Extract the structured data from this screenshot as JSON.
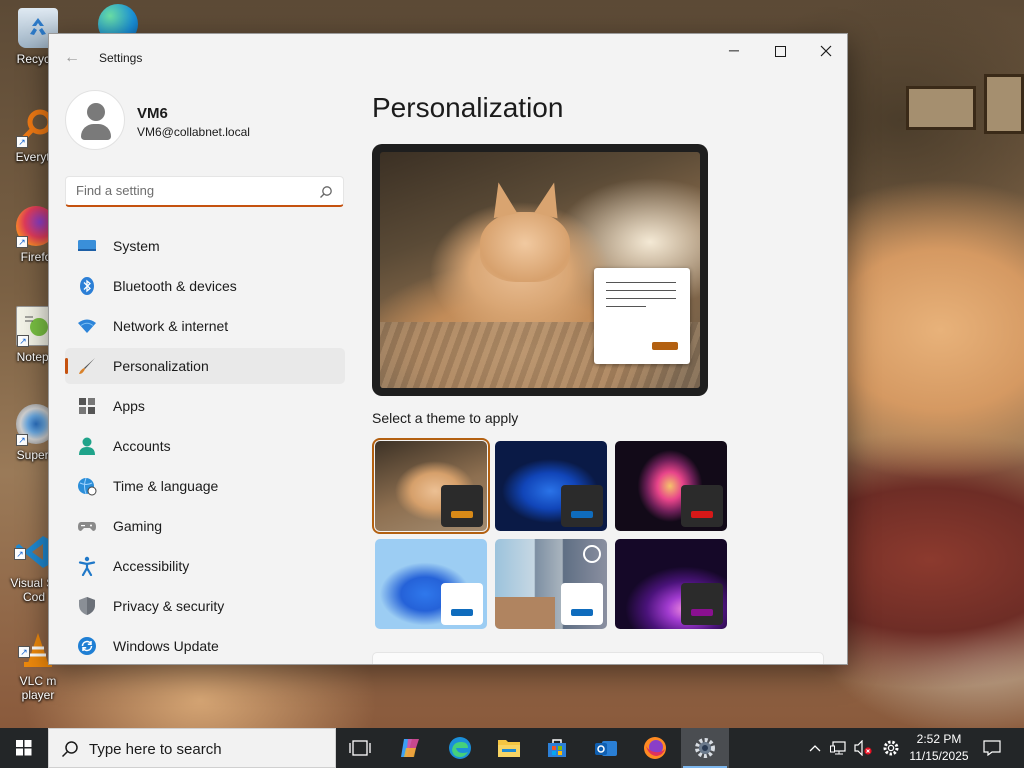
{
  "desktop": {
    "icons": [
      {
        "label": "Recycle"
      },
      {
        "label": "Everyth"
      },
      {
        "label": "Firefo"
      },
      {
        "label": "Notepa"
      },
      {
        "label": "Supern"
      },
      {
        "label": "Visual St\nCod"
      },
      {
        "label": "VLC m\nplayer"
      }
    ]
  },
  "window": {
    "title": "Settings",
    "controls": {
      "minimize": "─",
      "maximize": "☐",
      "close": "✕"
    }
  },
  "user": {
    "name": "VM6",
    "email": "VM6@collabnet.local"
  },
  "search": {
    "placeholder": "Find a setting",
    "value": ""
  },
  "nav": {
    "items": [
      {
        "label": "System",
        "icon": "monitor-icon"
      },
      {
        "label": "Bluetooth & devices",
        "icon": "bluetooth-icon"
      },
      {
        "label": "Network & internet",
        "icon": "wifi-icon"
      },
      {
        "label": "Personalization",
        "icon": "brush-icon",
        "selected": true
      },
      {
        "label": "Apps",
        "icon": "apps-icon"
      },
      {
        "label": "Accounts",
        "icon": "person-icon"
      },
      {
        "label": "Time & language",
        "icon": "globe-clock-icon"
      },
      {
        "label": "Gaming",
        "icon": "controller-icon"
      },
      {
        "label": "Accessibility",
        "icon": "accessibility-icon"
      },
      {
        "label": "Privacy & security",
        "icon": "shield-icon"
      },
      {
        "label": "Windows Update",
        "icon": "update-icon"
      }
    ]
  },
  "main": {
    "title": "Personalization",
    "themes_label": "Select a theme to apply",
    "themes": [
      {
        "name": "cat-photo",
        "accent": "#d98a17",
        "selected": true
      },
      {
        "name": "windows-dark",
        "accent": "#0f6cbd"
      },
      {
        "name": "glow",
        "accent": "#d61818"
      },
      {
        "name": "windows-light",
        "accent": "#0f6cbd"
      },
      {
        "name": "captured-motion",
        "accent": "#0f6cbd"
      },
      {
        "name": "sunrise",
        "accent": "#8a1090"
      }
    ]
  },
  "taskbar": {
    "search_placeholder": "Type here to search",
    "time": "2:52 PM",
    "date": "11/15/2025"
  },
  "colors": {
    "accent": "#c5520f",
    "taskbar": "#232628",
    "window_bg": "#f3f3f3"
  }
}
